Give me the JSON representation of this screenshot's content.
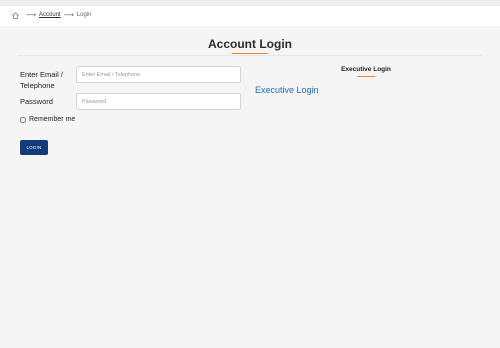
{
  "breadcrumb": {
    "home_icon": "home-icon",
    "account_label": "Account",
    "current_label": "Login"
  },
  "page": {
    "title": "Account Login"
  },
  "form": {
    "email_label": "Enter Email / Telephone",
    "email_placeholder": "Enter Email / Telephone",
    "password_label": "Password",
    "password_placeholder": "Password",
    "remember_label": "Remember me",
    "login_button": "LOGIN"
  },
  "executive": {
    "heading": "Executive Login",
    "link_label": "Executive Login"
  },
  "colors": {
    "accent": "#e08a33",
    "button": "#123b7a",
    "link": "#2b6cb8"
  }
}
